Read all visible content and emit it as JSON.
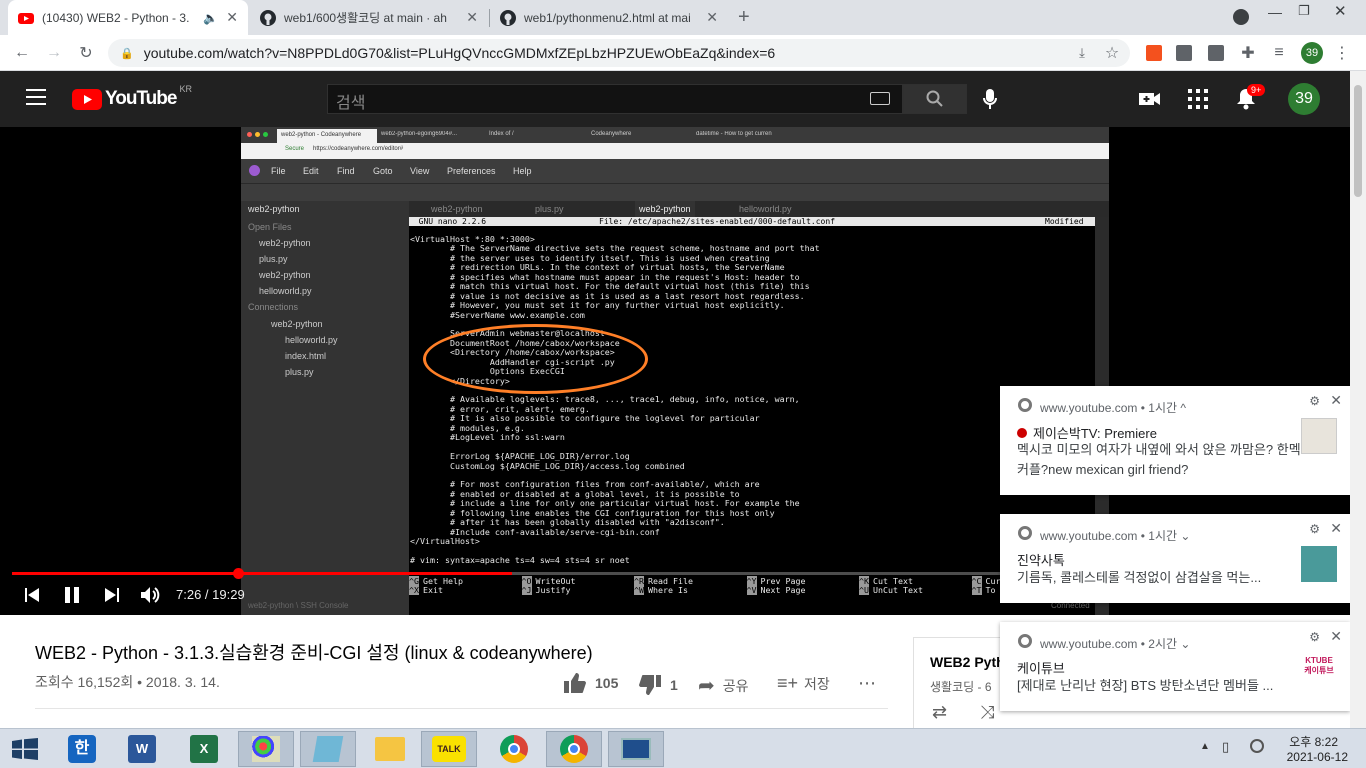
{
  "browser": {
    "tabs": [
      {
        "title": "(10430) WEB2 - Python - 3.",
        "active": true
      },
      {
        "title": "web1/600생활코딩 at main · ah",
        "active": false
      },
      {
        "title": "web1/pythonmenu2.html at mai",
        "active": false
      }
    ],
    "url": "youtube.com/watch?v=N8PPDLd0G70&list=PLuHgQVnccGMDMxfZEpLbzHPZUEwObEaZq&index=6",
    "profile_number": "39"
  },
  "youtube": {
    "logo_text": "YouTube",
    "region": "KR",
    "search_placeholder": "검색",
    "notification_count": "9+",
    "avatar": "39"
  },
  "ide": {
    "browser_tabs": [
      "web2-python - Codeanywhere",
      "web2-python-egoing6904#...",
      "Index of /",
      "Codeanywhere",
      "datetime - How to get curren"
    ],
    "url": "https://codeanywhere.com/editor#",
    "secure_label": "Secure",
    "menu": [
      "File",
      "Edit",
      "Find",
      "Goto",
      "View",
      "Preferences",
      "Help"
    ],
    "project": "web2-python",
    "open_files_label": "Open Files",
    "open_files": [
      "web2-python",
      "plus.py",
      "web2-python",
      "helloworld.py"
    ],
    "connections_label": "Connections",
    "connection": "web2-python",
    "connection_files": [
      "helloworld.py",
      "index.html",
      "plus.py"
    ],
    "editor_tabs": [
      "web2-python",
      "plus.py",
      "web2-python",
      "helloworld.py"
    ],
    "console_label": "web2-python \\ SSH Console",
    "connected_label": "Connected",
    "nano_version": "  GNU nano 2.2.6",
    "nano_file": "File: /etc/apache2/sites-enabled/000-default.conf",
    "nano_status": "Modified",
    "lines": [
      "<VirtualHost *:80 *:3000>",
      "        # The ServerName directive sets the request scheme, hostname and port that",
      "        # the server uses to identify itself. This is used when creating",
      "        # redirection URLs. In the context of virtual hosts, the ServerName",
      "        # specifies what hostname must appear in the request's Host: header to",
      "        # match this virtual host. For the default virtual host (this file) this",
      "        # value is not decisive as it is used as a last resort host regardless.",
      "        # However, you must set it for any further virtual host explicitly.",
      "        #ServerName www.example.com",
      "",
      "        ServerAdmin webmaster@localhost",
      "        DocumentRoot /home/cabox/workspace",
      "        <Directory /home/cabox/workspace>",
      "                AddHandler cgi-script .py",
      "                Options ExecCGI",
      "        </Directory>",
      "",
      "        # Available loglevels: trace8, ..., trace1, debug, info, notice, warn,",
      "        # error, crit, alert, emerg.",
      "        # It is also possible to configure the loglevel for particular",
      "        # modules, e.g.",
      "        #LogLevel info ssl:warn",
      "",
      "        ErrorLog ${APACHE_LOG_DIR}/error.log",
      "        CustomLog ${APACHE_LOG_DIR}/access.log combined",
      "",
      "        # For most configuration files from conf-available/, which are",
      "        # enabled or disabled at a global level, it is possible to",
      "        # include a line for only one particular virtual host. For example the",
      "        # following line enables the CGI configuration for this host only",
      "        # after it has been globally disabled with \"a2disconf\".",
      "        #Include conf-available/serve-cgi-bin.conf",
      "</VirtualHost>",
      "",
      "# vim: syntax=apache ts=4 sw=4 sts=4 sr noet"
    ],
    "shortcuts": [
      {
        "k1": "^G",
        "l1": "Get Help",
        "k2": "^X",
        "l2": "Exit"
      },
      {
        "k1": "^O",
        "l1": "WriteOut",
        "k2": "^J",
        "l2": "Justify"
      },
      {
        "k1": "^R",
        "l1": "Read File",
        "k2": "^W",
        "l2": "Where Is"
      },
      {
        "k1": "^Y",
        "l1": "Prev Page",
        "k2": "^V",
        "l2": "Next Page"
      },
      {
        "k1": "^K",
        "l1": "Cut Text",
        "k2": "^U",
        "l2": "UnCut Text"
      },
      {
        "k1": "^C",
        "l1": "Cur",
        "k2": "^T",
        "l2": "To"
      }
    ]
  },
  "player": {
    "time": "7:26 / 19:29",
    "progress": 0.377
  },
  "video_info": {
    "title": "WEB2 - Python - 3.1.3.실습환경 준비-CGI 설정 (linux & codeanywhere)",
    "meta": "조회수 16,152회 • 2018. 3. 14.",
    "likes": "105",
    "dislikes": "1",
    "share": "공유",
    "save": "저장"
  },
  "playlist": {
    "title": "WEB2 Pyth",
    "channel": "생활코딩 - 6"
  },
  "notifications": [
    {
      "source": "www.youtube.com",
      "time": "1시간",
      "caret": "^",
      "title": "제이슨박TV: Premiere",
      "body": "멕시코 미모의 여자가 내옆에 와서 앉은 까맘은? 한멕커플?new mexican girl friend?"
    },
    {
      "source": "www.youtube.com",
      "time": "1시간",
      "caret": "⌄",
      "title": "진약사톡",
      "body": "기름독, 콜레스테롤 걱정없이 삼겹살을 먹는..."
    },
    {
      "source": "www.youtube.com",
      "time": "2시간",
      "caret": "⌄",
      "title": "케이튜브",
      "body": "[제대로 난리난 현장] BTS 방탄소년단 멤버들 ...",
      "thumb_text": "KTUBE 케이튜브"
    }
  ],
  "taskbar": {
    "time": "오후 8:22",
    "date": "2021-06-12",
    "kakao_label": "TALK"
  }
}
